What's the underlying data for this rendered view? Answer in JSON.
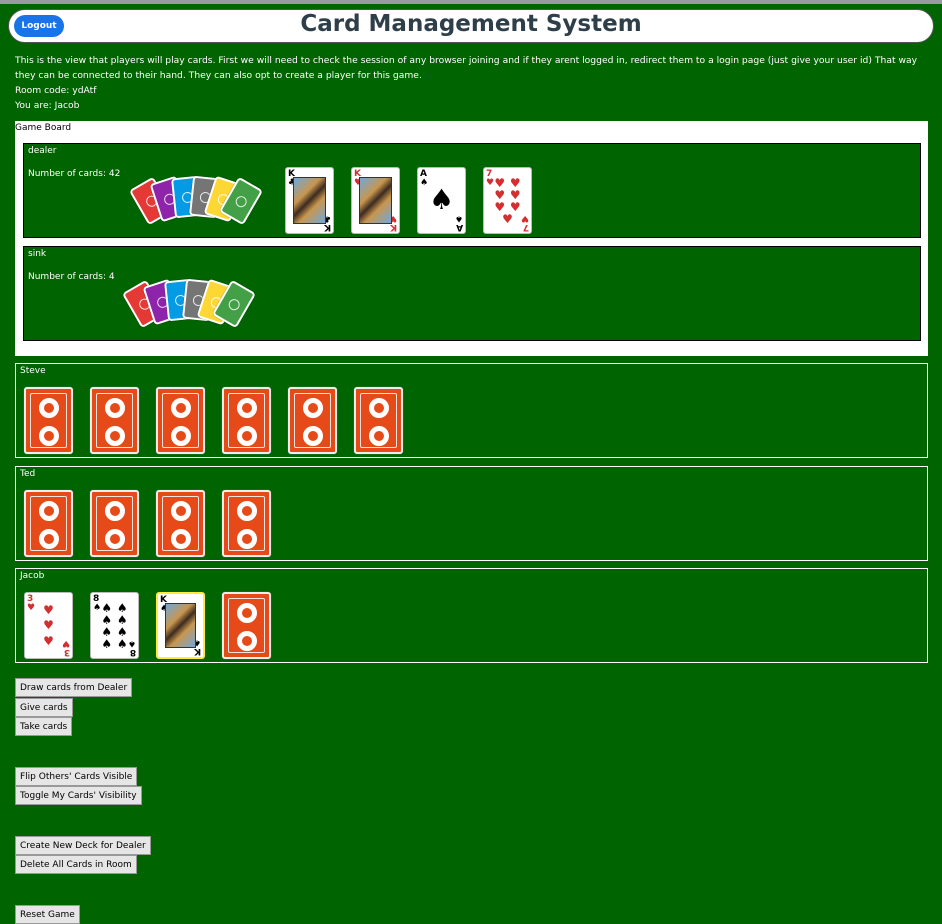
{
  "header": {
    "title": "Card Management System",
    "logout_label": "Logout"
  },
  "intro": {
    "description": "This is the view that players will play cards. First we will need to check the session of any browser joining and if they arent logged in, redirect them to a login page (just give your user id) That way they can be connected to their hand. They can also opt to create a player for this game.",
    "room_code": "Room code: ydAtf",
    "you_are": "You are: Jacob"
  },
  "board": {
    "label": "Game Board",
    "piles": [
      {
        "name": "dealer",
        "count_text": "Number of cards: 42",
        "face_up": [
          {
            "rank": "K",
            "suit": "♣",
            "color": "black",
            "court": true
          },
          {
            "rank": "K",
            "suit": "♥",
            "color": "red",
            "court": true
          },
          {
            "rank": "A",
            "suit": "♠",
            "color": "black",
            "court": false
          },
          {
            "rank": "7",
            "suit": "♥",
            "color": "red",
            "court": false
          }
        ]
      },
      {
        "name": "sink",
        "count_text": "Number of cards: 4",
        "face_up": []
      }
    ],
    "fan_colors": [
      "#e53935",
      "#8e24aa",
      "#039be5",
      "#757575",
      "#fdd835",
      "#43a047"
    ]
  },
  "players": [
    {
      "name": "Steve",
      "cards": [
        {
          "back": true
        },
        {
          "back": true
        },
        {
          "back": true
        },
        {
          "back": true
        },
        {
          "back": true
        },
        {
          "back": true
        }
      ]
    },
    {
      "name": "Ted",
      "cards": [
        {
          "back": true
        },
        {
          "back": true
        },
        {
          "back": true
        },
        {
          "back": true
        }
      ]
    },
    {
      "name": "Jacob",
      "cards": [
        {
          "rank": "3",
          "suit": "♥",
          "color": "red"
        },
        {
          "rank": "8",
          "suit": "♠",
          "color": "black"
        },
        {
          "rank": "K",
          "suit": "♠",
          "color": "black",
          "court": true,
          "selected": true
        },
        {
          "back": true
        }
      ]
    }
  ],
  "buttons": {
    "draw": "Draw cards from Dealer",
    "give": "Give cards",
    "take": "Take cards",
    "flip_others": "Flip Others' Cards Visible",
    "toggle_mine": "Toggle My Cards' Visibility",
    "create_deck": "Create New Deck for Dealer",
    "delete_all": "Delete All Cards in Room",
    "reset": "Reset Game"
  },
  "colors": {
    "background": "#006400",
    "card_back": "#e64a19",
    "logout": "#1a73e8",
    "selected": "#ffeb3b"
  }
}
